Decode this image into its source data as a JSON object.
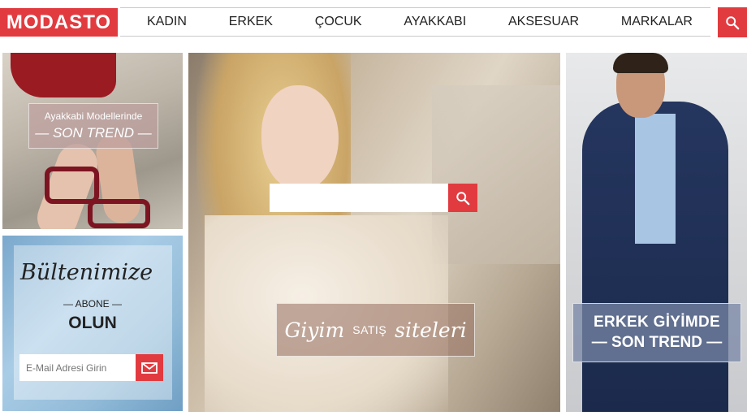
{
  "logo": {
    "text": "MODASTO"
  },
  "nav": {
    "items": [
      {
        "label": "KADIN"
      },
      {
        "label": "ERKEK"
      },
      {
        "label": "ÇOCUK"
      },
      {
        "label": "AYAKKABI"
      },
      {
        "label": "AKSESUAR"
      },
      {
        "label": "MARKALAR"
      }
    ]
  },
  "icons": {
    "search": "search-icon",
    "mail": "envelope-icon"
  },
  "colors": {
    "accent": "#e13b40",
    "nav_text": "#222222"
  },
  "shoes_panel": {
    "subtitle": "Ayakkabi Modellerinde",
    "title": "— SON TREND —"
  },
  "newsletter": {
    "title": "Bültenimize",
    "abone": "— ABONE —",
    "olun": "OLUN",
    "email_placeholder": "E-Mail Adresi Girin"
  },
  "hero": {
    "search_value": "",
    "caption_left": "Giyim",
    "caption_mid": "SATIŞ",
    "caption_right": "siteleri"
  },
  "men_panel": {
    "line1": "ERKEK GİYİMDE",
    "line2": "— SON TREND —"
  }
}
